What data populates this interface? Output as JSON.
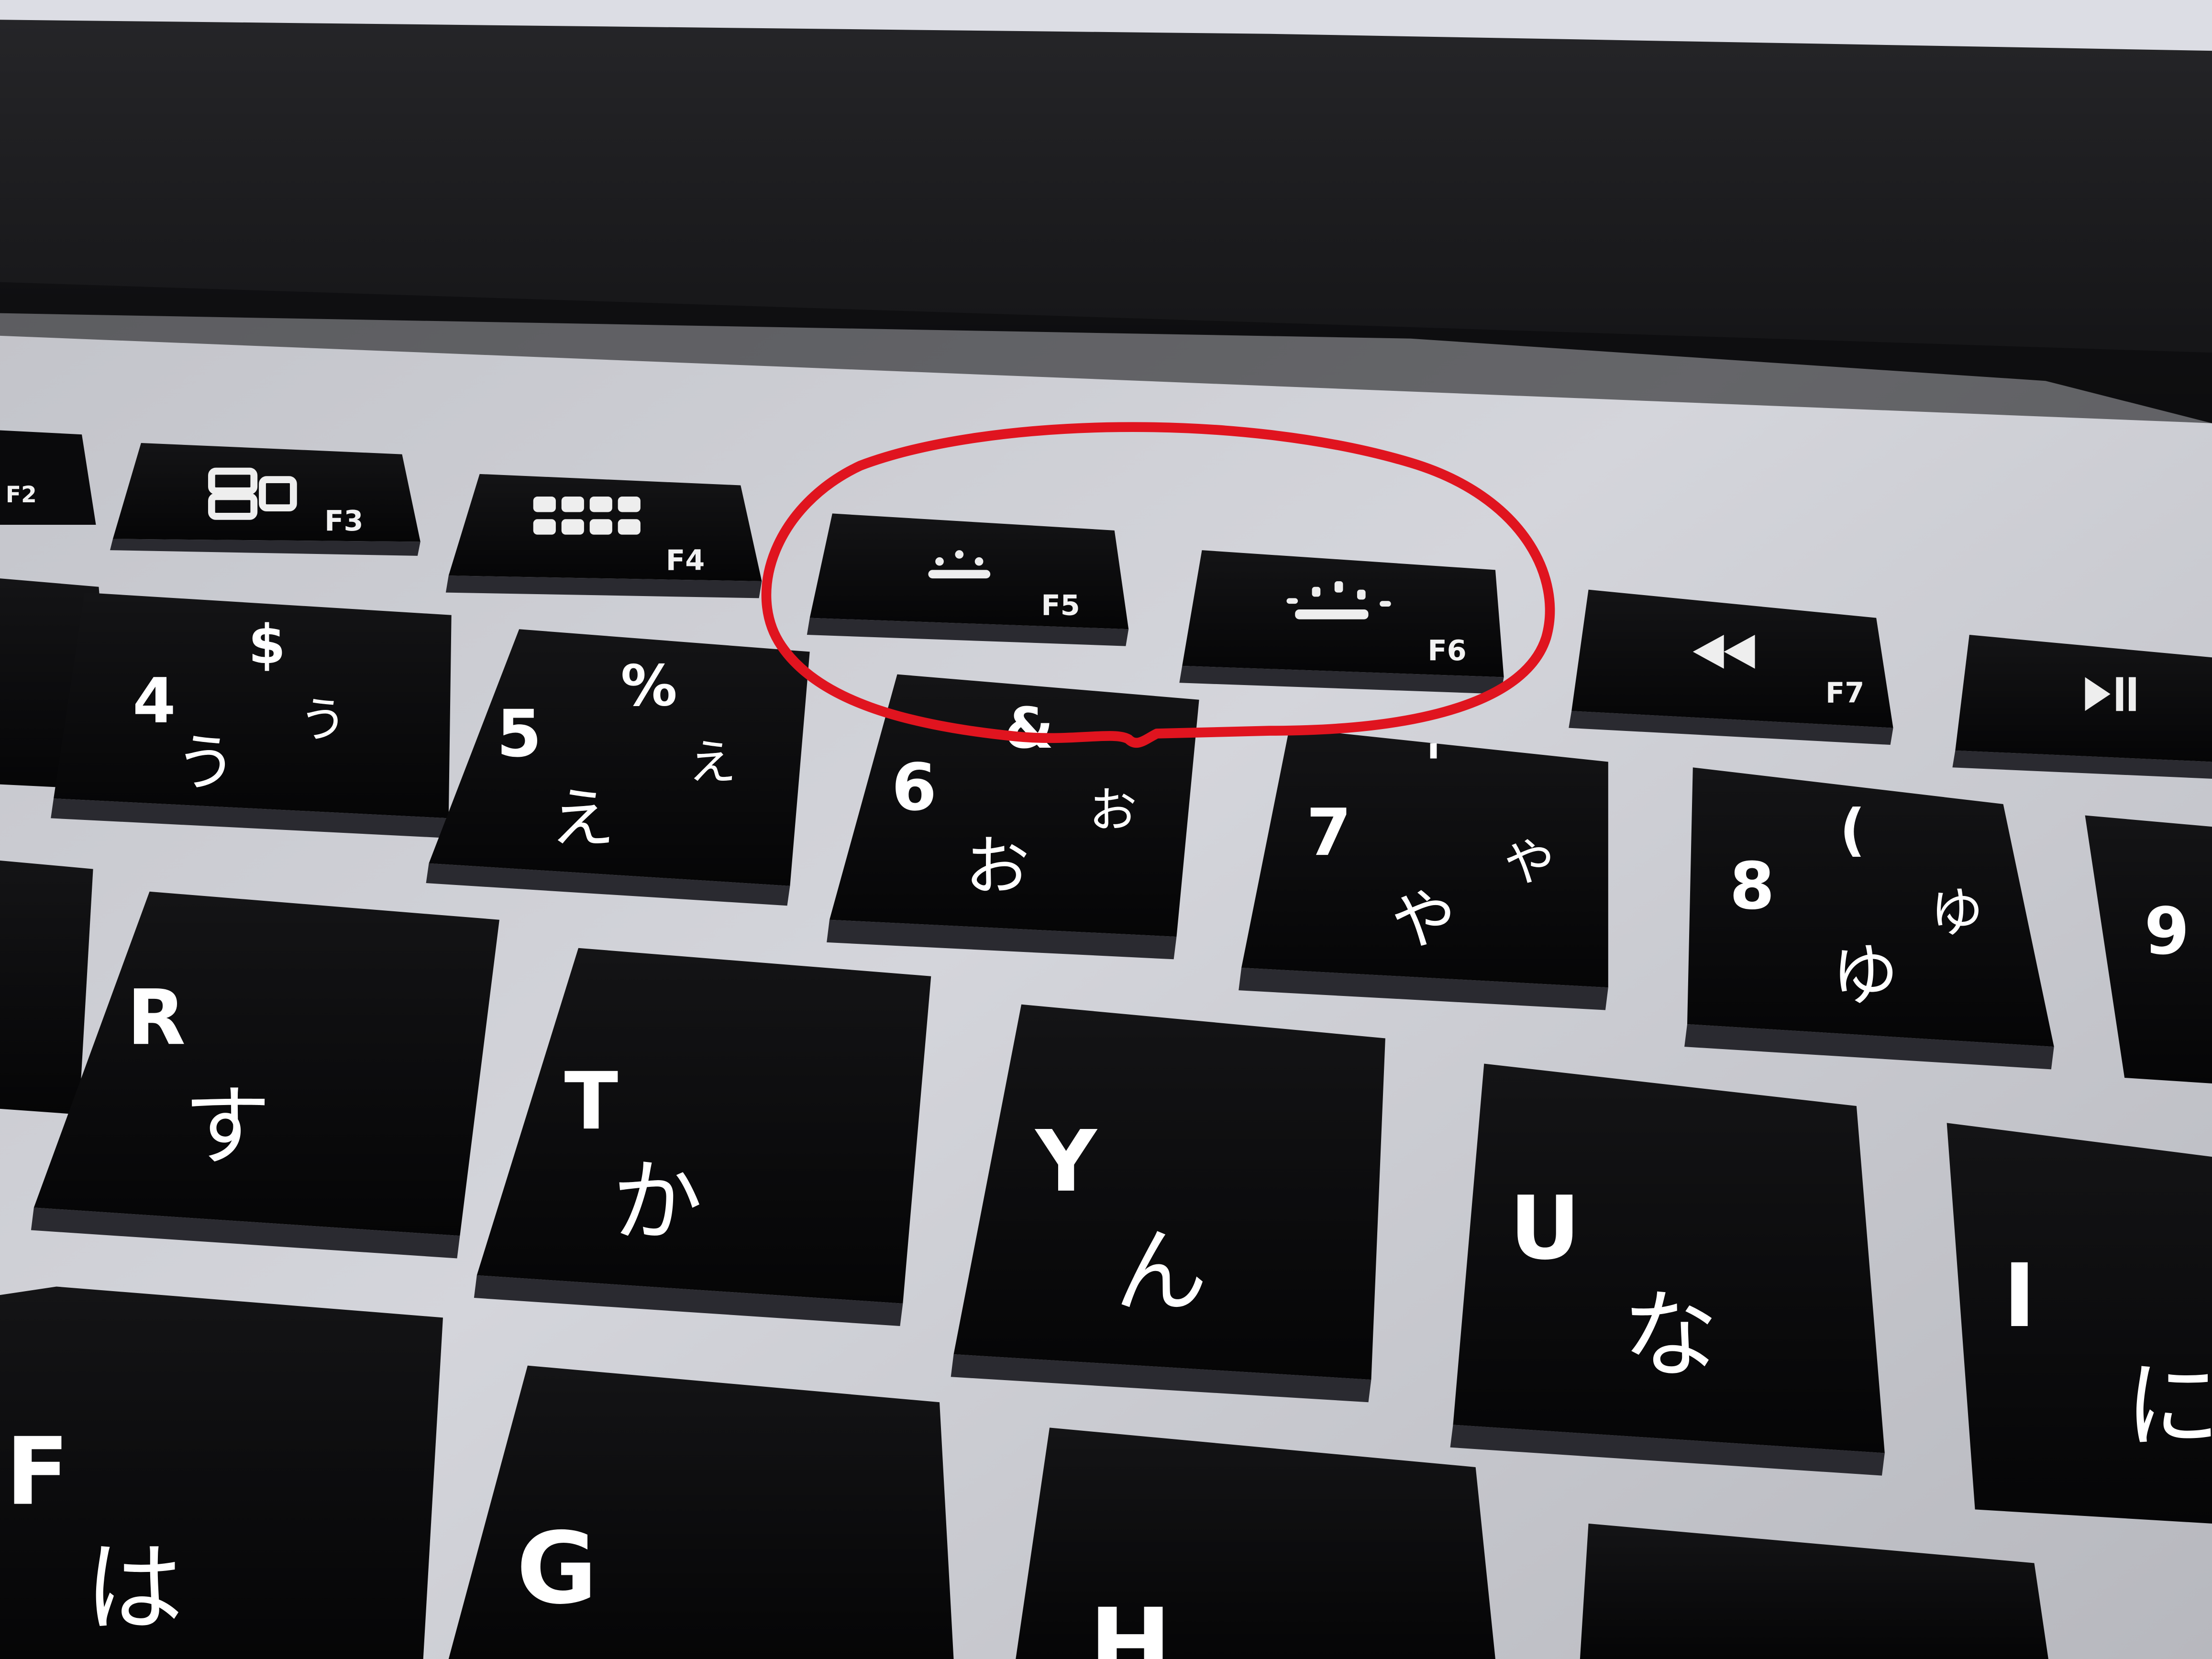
{
  "function_row": [
    {
      "id": "f2",
      "label": "F2",
      "icon": "brightness-up-icon"
    },
    {
      "id": "f3",
      "label": "F3",
      "icon": "mission-control-icon"
    },
    {
      "id": "f4",
      "label": "F4",
      "icon": "launchpad-icon"
    },
    {
      "id": "f5",
      "label": "F5",
      "icon": "keyboard-backlight-down-icon"
    },
    {
      "id": "f6",
      "label": "F6",
      "icon": "keyboard-backlight-up-icon"
    },
    {
      "id": "f7",
      "label": "F7",
      "icon": "rewind-icon"
    },
    {
      "id": "f8",
      "label": "",
      "icon": "play-pause-icon"
    }
  ],
  "number_row": [
    {
      "id": "4",
      "main": "4",
      "shift": "$",
      "kana_small": "う",
      "kana": "う"
    },
    {
      "id": "5",
      "main": "5",
      "shift": "%",
      "kana_small": "え",
      "kana": "え"
    },
    {
      "id": "6",
      "main": "6",
      "shift": "&",
      "kana_small": "お",
      "kana": "お"
    },
    {
      "id": "7",
      "main": "7",
      "shift": "'",
      "kana_small": "や",
      "kana": "や"
    },
    {
      "id": "8",
      "main": "8",
      "shift": "(",
      "kana_small": "ゆ",
      "kana": "ゆ"
    },
    {
      "id": "9",
      "main": "9",
      "shift": "",
      "kana_small": "",
      "kana": ""
    }
  ],
  "letter_row": [
    {
      "id": "r",
      "main": "R",
      "kana": "す"
    },
    {
      "id": "t",
      "main": "T",
      "kana": "か"
    },
    {
      "id": "y",
      "main": "Y",
      "kana": "ん"
    },
    {
      "id": "u",
      "main": "U",
      "kana": "な"
    },
    {
      "id": "i",
      "main": "I",
      "kana": "に"
    }
  ],
  "bottom_row": [
    {
      "id": "f",
      "main": "F",
      "kana": "は"
    },
    {
      "id": "g",
      "main": "G",
      "kana": ""
    },
    {
      "id": "h",
      "main": "H",
      "kana": ""
    }
  ],
  "colors": {
    "key": "#0c0c0e",
    "deck": "#c9c9cf",
    "bezel": "#1a1a1c",
    "annotation": "#e0141f"
  }
}
